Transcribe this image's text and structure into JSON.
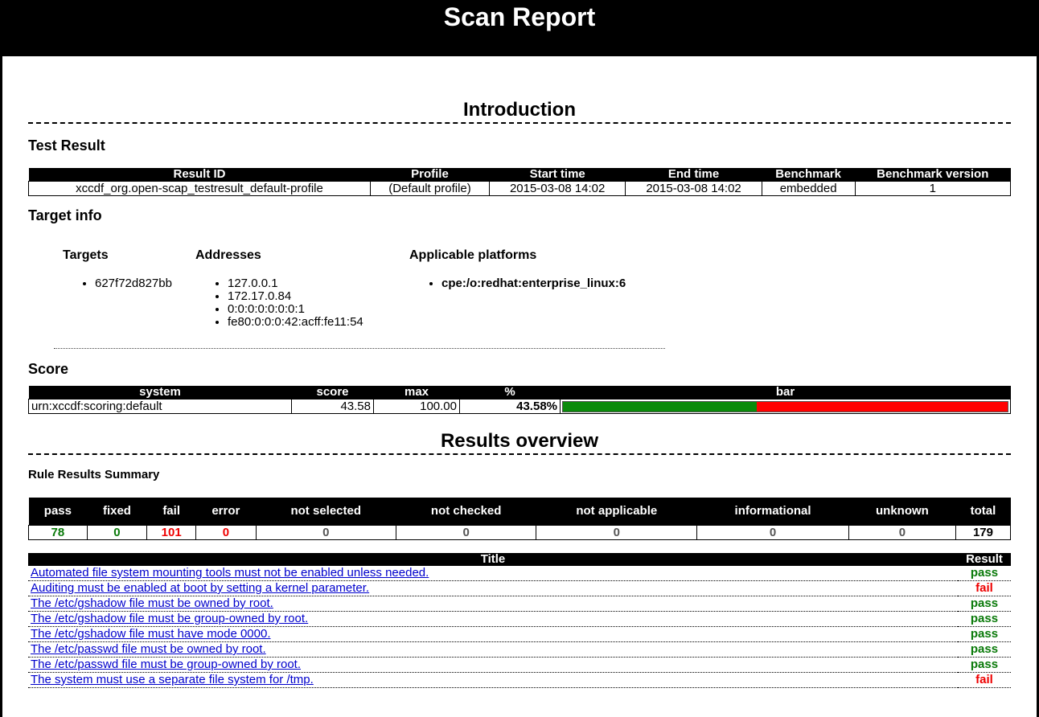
{
  "header": {
    "title": "Scan Report"
  },
  "introduction": {
    "heading": "Introduction",
    "test_result": {
      "heading": "Test Result",
      "columns": [
        "Result ID",
        "Profile",
        "Start time",
        "End time",
        "Benchmark",
        "Benchmark version"
      ],
      "row": [
        "xccdf_org.open-scap_testresult_default-profile",
        "(Default profile)",
        "2015-03-08 14:02",
        "2015-03-08 14:02",
        "embedded",
        "1"
      ]
    },
    "target_info": {
      "heading": "Target info",
      "targets_label": "Targets",
      "targets": [
        "627f72d827bb"
      ],
      "addresses_label": "Addresses",
      "addresses": [
        "127.0.0.1",
        "172.17.0.84",
        "0:0:0:0:0:0:0:1",
        "fe80:0:0:0:42:acff:fe11:54"
      ],
      "platforms_label": "Applicable platforms",
      "platforms": [
        "cpe:/o:redhat:enterprise_linux:6"
      ]
    },
    "score": {
      "heading": "Score",
      "columns": [
        "system",
        "score",
        "max",
        "%",
        "bar"
      ],
      "row": {
        "system": "urn:xccdf:scoring:default",
        "score": "43.58",
        "max": "100.00",
        "percent": "43.58%"
      },
      "bar_fraction": 0.4358,
      "bar_colors": {
        "pass": "#0a8a0a",
        "fail": "#ff0000"
      }
    }
  },
  "results_overview": {
    "heading": "Results overview",
    "summary_heading": "Rule Results Summary",
    "summary": {
      "columns": [
        "pass",
        "fixed",
        "fail",
        "error",
        "not selected",
        "not checked",
        "not applicable",
        "informational",
        "unknown",
        "total"
      ],
      "values": [
        "78",
        "0",
        "101",
        "0",
        "0",
        "0",
        "0",
        "0",
        "0",
        "179"
      ]
    },
    "rules": {
      "columns": [
        "Title",
        "Result"
      ],
      "rows": [
        {
          "title": "Automated file system mounting tools must not be enabled unless needed.",
          "result": "pass"
        },
        {
          "title": "Auditing must be enabled at boot by setting a kernel parameter.",
          "result": "fail"
        },
        {
          "title": "The /etc/gshadow file must be owned by root.",
          "result": "pass"
        },
        {
          "title": "The /etc/gshadow file must be group-owned by root.",
          "result": "pass"
        },
        {
          "title": "The /etc/gshadow file must have mode 0000.",
          "result": "pass"
        },
        {
          "title": "The /etc/passwd file must be owned by root.",
          "result": "pass"
        },
        {
          "title": "The /etc/passwd file must be group-owned by root.",
          "result": "pass"
        },
        {
          "title": "The system must use a separate file system for /tmp.",
          "result": "fail"
        }
      ]
    }
  }
}
